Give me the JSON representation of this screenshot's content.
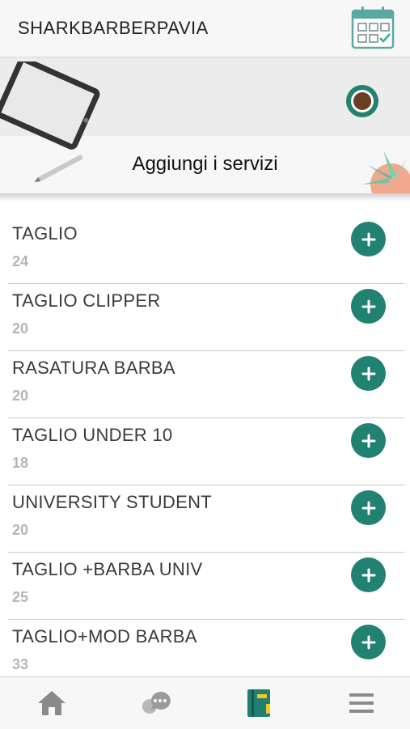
{
  "header": {
    "title": "SHARKBARBERPAVIA",
    "calendar_icon": "calendar-check-icon"
  },
  "banner": {
    "title": "Aggiungi i servizi"
  },
  "services": [
    {
      "name": "TAGLIO",
      "price": "24"
    },
    {
      "name": "TAGLIO CLIPPER",
      "price": "20"
    },
    {
      "name": "RASATURA BARBA",
      "price": "20"
    },
    {
      "name": "TAGLIO UNDER 10",
      "price": "18"
    },
    {
      "name": "UNIVERSITY STUDENT",
      "price": "20"
    },
    {
      "name": "TAGLIO +BARBA UNIV",
      "price": "25"
    },
    {
      "name": "TAGLIO+MOD BARBA",
      "price": "33"
    }
  ],
  "nav": [
    {
      "icon": "home-icon"
    },
    {
      "icon": "chat-icon"
    },
    {
      "icon": "notebook-icon",
      "active": true
    },
    {
      "icon": "menu-icon"
    }
  ],
  "colors": {
    "accent": "#228271",
    "price_gray": "#b5b5b5"
  }
}
